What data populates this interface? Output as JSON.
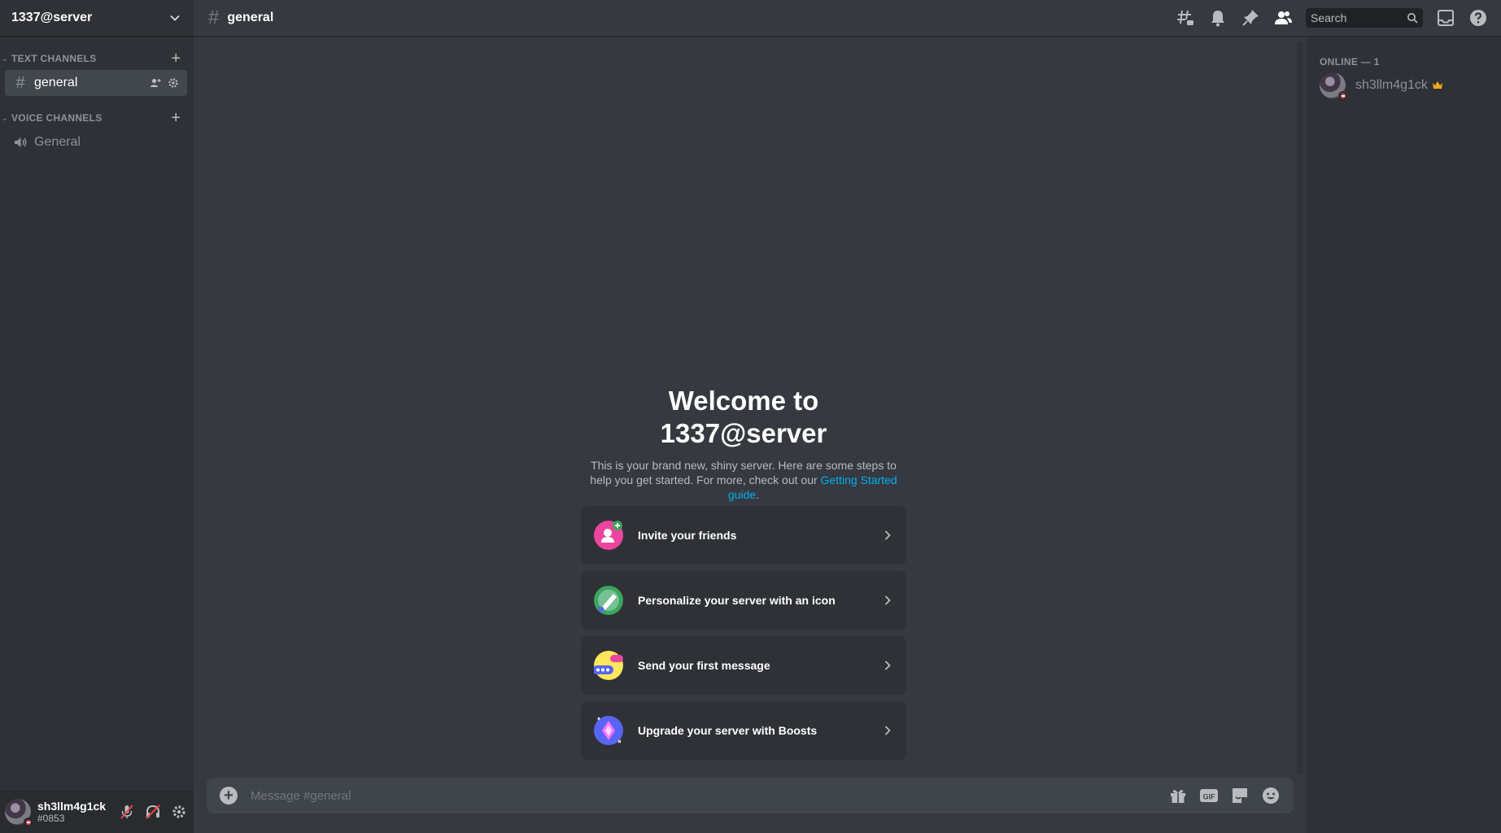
{
  "server": {
    "name": "1337@server"
  },
  "sidebar": {
    "categories": [
      {
        "label": "TEXT CHANNELS",
        "channels": [
          {
            "name": "general"
          }
        ]
      },
      {
        "label": "VOICE CHANNELS",
        "channels": [
          {
            "name": "General"
          }
        ]
      }
    ]
  },
  "header": {
    "channel": "general",
    "search_placeholder": "Search"
  },
  "welcome": {
    "title_line1": "Welcome to",
    "title_line2": "1337@server",
    "subtitle": "This is your brand new, shiny server. Here are some steps to help you get started. For more, check out our ",
    "link": "Getting Started guide",
    "link_suffix": "."
  },
  "cards": [
    {
      "label": "Invite your friends",
      "icon": "invite-friends-icon",
      "color": "#eb459e"
    },
    {
      "label": "Personalize your server with an icon",
      "icon": "personalize-icon",
      "color": "#3ba55c"
    },
    {
      "label": "Send your first message",
      "icon": "first-message-icon",
      "color": "#fee75c"
    },
    {
      "label": "Upgrade your server with Boosts",
      "icon": "boost-icon",
      "color": "#5865f2"
    }
  ],
  "composer": {
    "placeholder": "Message #general",
    "gif_label": "GIF"
  },
  "members": {
    "header": "ONLINE — 1",
    "list": [
      {
        "name": "sh3llm4g1ck"
      }
    ]
  },
  "user": {
    "name": "sh3llm4g1ck",
    "tag": "#0853"
  },
  "colors": {
    "background": "#36393f",
    "sidebar": "#2f3136",
    "accent_link": "#00aff4",
    "dnd": "#ed4245",
    "crown": "#faa81a"
  }
}
